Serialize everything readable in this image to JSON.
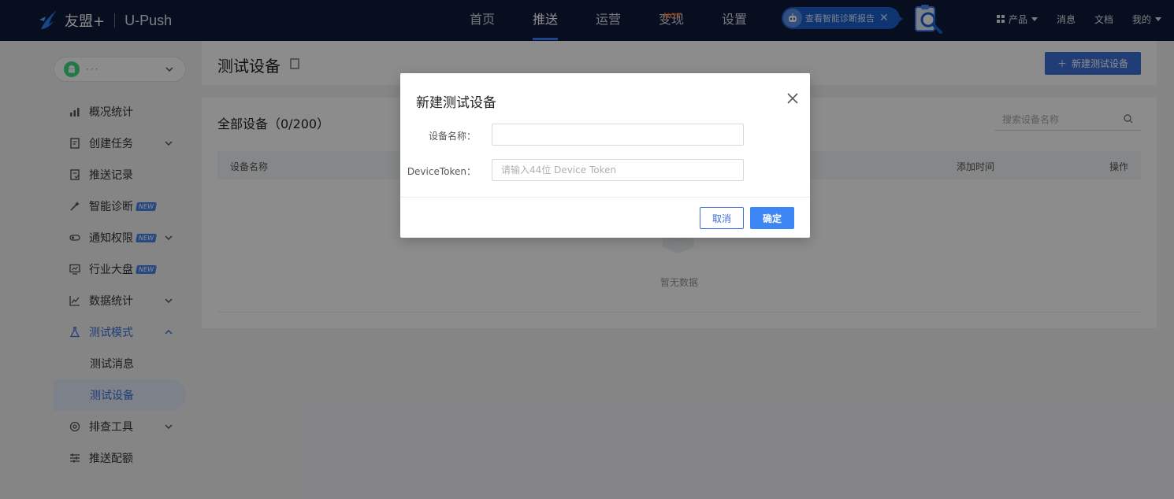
{
  "header": {
    "logo_text": "友盟+",
    "product_name": "U-Push",
    "nav": [
      {
        "label": "首页",
        "active": false
      },
      {
        "label": "推送",
        "active": true
      },
      {
        "label": "运营",
        "active": false
      },
      {
        "label": "变现",
        "active": false,
        "badge": "HOT"
      },
      {
        "label": "设置",
        "active": false
      }
    ],
    "diagnosis_pill": "查看智能诊断报告",
    "right_links": {
      "products": "产品",
      "messages": "消息",
      "docs": "文档",
      "mine": "我的"
    }
  },
  "sidebar": {
    "app_selector": {
      "name": "···",
      "icon": "android-icon"
    },
    "items": [
      {
        "label": "概况统计",
        "icon": "chart-bars-icon"
      },
      {
        "label": "创建任务",
        "icon": "task-doc-icon",
        "expandable": true
      },
      {
        "label": "推送记录",
        "icon": "record-doc-icon"
      },
      {
        "label": "智能诊断",
        "icon": "wand-icon",
        "badge": "NEW"
      },
      {
        "label": "通知权限",
        "icon": "toggle-icon",
        "badge": "NEW",
        "expandable": true
      },
      {
        "label": "行业大盘",
        "icon": "monitor-icon",
        "badge": "NEW"
      },
      {
        "label": "数据统计",
        "icon": "line-chart-icon",
        "expandable": true
      },
      {
        "label": "测试模式",
        "icon": "flask-icon",
        "expanded": true
      },
      {
        "label": "测试消息",
        "sub": true
      },
      {
        "label": "测试设备",
        "sub": true,
        "active": true
      },
      {
        "label": "排查工具",
        "icon": "troubleshoot-icon",
        "expandable": true
      },
      {
        "label": "推送配额",
        "icon": "sliders-icon"
      }
    ]
  },
  "page": {
    "title": "测试设备",
    "new_button": "新建测试设备",
    "panel_title": "全部设备（0/200）",
    "search_placeholder": "搜索设备名称",
    "columns": [
      "设备名称",
      "添加时间",
      "操作"
    ],
    "empty_text": "暂无数据"
  },
  "modal": {
    "title": "新建测试设备",
    "fields": [
      {
        "label": "设备名称：",
        "value": "",
        "placeholder": ""
      },
      {
        "label": "DeviceToken：",
        "value": "",
        "placeholder": "请输入44位 Device Token"
      }
    ],
    "cancel_label": "取消",
    "ok_label": "确定"
  },
  "colors": {
    "topbar": "#0d1a3a",
    "accent": "#3d6fd8",
    "primary_button": "#3d86f5",
    "hot": "#ff6a28"
  }
}
